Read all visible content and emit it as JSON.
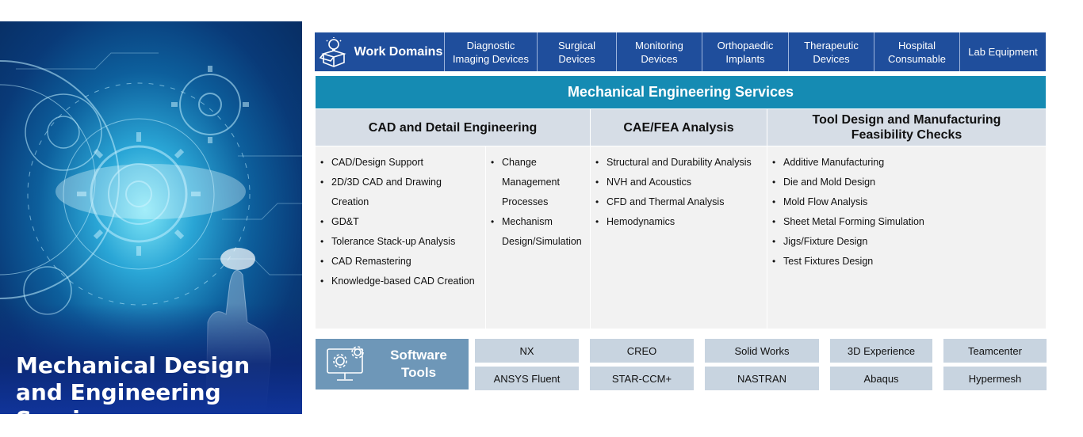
{
  "hero": {
    "title": "Mechanical Design and Engineering Services"
  },
  "domains": {
    "label": "Work Domains",
    "icon": "box-lightbulb-icon",
    "items": [
      "Diagnostic Imaging Devices",
      "Surgical Devices",
      "Monitoring Devices",
      "Orthopaedic Implants",
      "Therapeutic Devices",
      "Hospital Consumable",
      "Lab Equipment"
    ]
  },
  "services": {
    "title": "Mechanical Engineering Services",
    "columns": [
      {
        "heading": "CAD and Detail Engineering",
        "items_left": [
          "CAD/Design Support",
          "2D/3D CAD and Drawing Creation",
          "GD&T",
          "Tolerance Stack-up Analysis",
          "CAD Remastering",
          "Knowledge-based CAD Creation"
        ],
        "items_right": [
          "Change Management Processes",
          "Mechanism Design/Simulation"
        ]
      },
      {
        "heading": "CAE/FEA Analysis",
        "items": [
          "Structural and Durability Analysis",
          "NVH and Acoustics",
          "CFD and Thermal Analysis",
          "Hemodynamics"
        ]
      },
      {
        "heading": "Tool Design and Manufacturing Feasibility Checks",
        "items": [
          "Additive Manufacturing",
          "Die  and Mold Design",
          "Mold Flow Analysis",
          "Sheet Metal Forming Simulation",
          "Jigs/Fixture Design",
          "Test Fixtures Design"
        ]
      }
    ]
  },
  "software": {
    "label": "Software Tools",
    "icon": "monitor-gears-icon",
    "tools": [
      "NX",
      "CREO",
      "Solid Works",
      "3D Experience",
      "Teamcenter",
      "ANSYS Fluent",
      "STAR-CCM+",
      "NASTRAN",
      "Abaqus",
      "Hypermesh"
    ]
  },
  "colors": {
    "domain_bar": "#1f4e9c",
    "services_header": "#158bb3",
    "column_header": "#d6dde6",
    "column_body": "#f2f2f2",
    "software_label": "#6e97b8",
    "tool_cell": "#c8d4e0"
  }
}
